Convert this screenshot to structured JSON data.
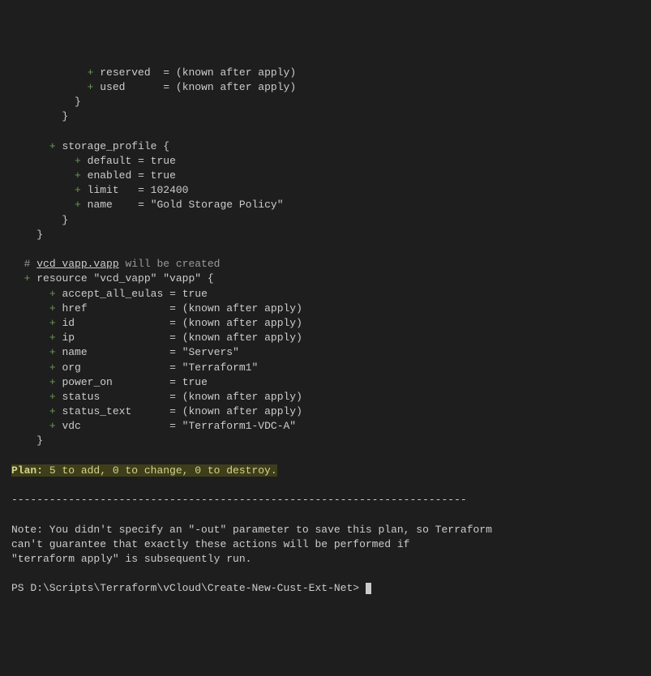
{
  "mem_lines": [
    {
      "indent": "            ",
      "key": "reserved",
      "pad": "  ",
      "value": "(known after apply)"
    },
    {
      "indent": "            ",
      "key": "used",
      "pad": "      ",
      "value": "(known after apply)"
    }
  ],
  "storage": {
    "header": "storage_profile {",
    "lines": [
      {
        "key": "default",
        "pad": " ",
        "value": "true"
      },
      {
        "key": "enabled",
        "pad": " ",
        "value": "true"
      },
      {
        "key": "limit",
        "pad": "   ",
        "value": "102400"
      },
      {
        "key": "name",
        "pad": "    ",
        "value": "\"Gold Storage Policy\""
      }
    ]
  },
  "vapp": {
    "comment_prefix": "# ",
    "resource_ref": "vcd_vapp.vapp",
    "comment_suffix": " will be created",
    "resource_line": "resource \"vcd_vapp\" \"vapp\" {",
    "lines": [
      {
        "key": "accept_all_eulas",
        "pad": " ",
        "value": "true"
      },
      {
        "key": "href",
        "pad": "             ",
        "value": "(known after apply)"
      },
      {
        "key": "id",
        "pad": "               ",
        "value": "(known after apply)"
      },
      {
        "key": "ip",
        "pad": "               ",
        "value": "(known after apply)"
      },
      {
        "key": "name",
        "pad": "             ",
        "value": "\"Servers\""
      },
      {
        "key": "org",
        "pad": "              ",
        "value": "\"Terraform1\""
      },
      {
        "key": "power_on",
        "pad": "         ",
        "value": "true"
      },
      {
        "key": "status",
        "pad": "           ",
        "value": "(known after apply)"
      },
      {
        "key": "status_text",
        "pad": "      ",
        "value": "(known after apply)"
      },
      {
        "key": "vdc",
        "pad": "              ",
        "value": "\"Terraform1-VDC-A\""
      }
    ]
  },
  "plan": {
    "label": "Plan:",
    "text": " 5 to add, 0 to change, 0 to destroy."
  },
  "separator": "------------------------------------------------------------------------",
  "note": {
    "l1": "Note: You didn't specify an \"-out\" parameter to save this plan, so Terraform",
    "l2": "can't guarantee that exactly these actions will be performed if",
    "l3": "\"terraform apply\" is subsequently run."
  },
  "prompt": "PS D:\\Scripts\\Terraform\\vCloud\\Create-New-Cust-Ext-Net> "
}
